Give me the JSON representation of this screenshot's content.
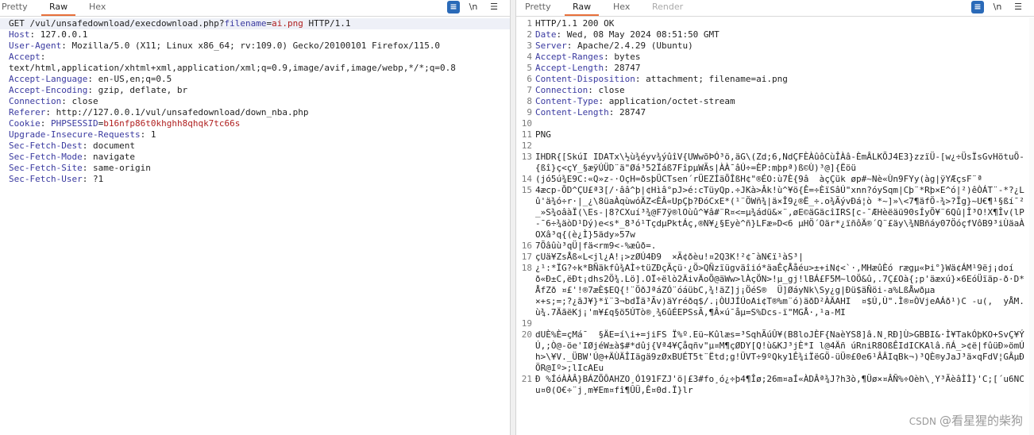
{
  "request": {
    "tabs": [
      "Pretty",
      "Raw",
      "Hex"
    ],
    "active_tab": "Raw",
    "lines": [
      {
        "num": "",
        "parts": [
          [
            "kw",
            "GET /vul/unsafedownload/execdownload.php?"
          ],
          [
            "param",
            "filename"
          ],
          [
            "kw",
            "="
          ],
          [
            "val",
            "ai.png"
          ],
          [
            "kw",
            " HTTP/1.1"
          ]
        ]
      },
      {
        "num": "",
        "parts": [
          [
            "key",
            "Host"
          ],
          [
            "kw",
            ": 127.0.0.1"
          ]
        ]
      },
      {
        "num": "",
        "parts": [
          [
            "key",
            "User-Agent"
          ],
          [
            "kw",
            ": Mozilla/5.0 (X11; Linux x86_64; rv:109.0) Gecko/20100101 Firefox/115.0"
          ]
        ]
      },
      {
        "num": "",
        "parts": [
          [
            "key",
            "Accept"
          ],
          [
            "kw",
            ":"
          ]
        ]
      },
      {
        "num": "",
        "parts": [
          [
            "kw",
            "text/html,application/xhtml+xml,application/xml;q=0.9,image/avif,image/webp,*/*;q=0.8"
          ]
        ]
      },
      {
        "num": "",
        "parts": [
          [
            "key",
            "Accept-Language"
          ],
          [
            "kw",
            ": en-US,en;q=0.5"
          ]
        ]
      },
      {
        "num": "",
        "parts": [
          [
            "key",
            "Accept-Encoding"
          ],
          [
            "kw",
            ": gzip, deflate, br"
          ]
        ]
      },
      {
        "num": "",
        "parts": [
          [
            "key",
            "Connection"
          ],
          [
            "kw",
            ": close"
          ]
        ]
      },
      {
        "num": "",
        "parts": [
          [
            "key",
            "Referer"
          ],
          [
            "kw",
            ": http://127.0.0.1/vul/unsafedownload/down_nba.php"
          ]
        ]
      },
      {
        "num": "",
        "parts": [
          [
            "key",
            "Cookie"
          ],
          [
            "kw",
            ": "
          ],
          [
            "param",
            "PHPSESSID"
          ],
          [
            "kw",
            "="
          ],
          [
            "val",
            "b16nfp86t0khghh8qhqk7tc66s"
          ]
        ]
      },
      {
        "num": "",
        "parts": [
          [
            "key",
            "Upgrade-Insecure-Requests"
          ],
          [
            "kw",
            ": 1"
          ]
        ]
      },
      {
        "num": "",
        "parts": [
          [
            "key",
            "Sec-Fetch-Dest"
          ],
          [
            "kw",
            ": document"
          ]
        ]
      },
      {
        "num": "",
        "parts": [
          [
            "key",
            "Sec-Fetch-Mode"
          ],
          [
            "kw",
            ": navigate"
          ]
        ]
      },
      {
        "num": "",
        "parts": [
          [
            "key",
            "Sec-Fetch-Site"
          ],
          [
            "kw",
            ": same-origin"
          ]
        ]
      },
      {
        "num": "",
        "parts": [
          [
            "key",
            "Sec-Fetch-User"
          ],
          [
            "kw",
            ": ?1"
          ]
        ]
      },
      {
        "num": "",
        "parts": []
      },
      {
        "num": "",
        "parts": []
      }
    ]
  },
  "response": {
    "tabs": [
      "Pretty",
      "Raw",
      "Hex",
      "Render"
    ],
    "active_tab": "Raw",
    "lines": [
      {
        "num": "1",
        "parts": [
          [
            "kw",
            "HTTP/1.1 200 OK"
          ]
        ]
      },
      {
        "num": "2",
        "parts": [
          [
            "key",
            "Date"
          ],
          [
            "kw",
            ": Wed, 08 May 2024 08:51:50 GMT"
          ]
        ]
      },
      {
        "num": "3",
        "parts": [
          [
            "key",
            "Server"
          ],
          [
            "kw",
            ": Apache/2.4.29 (Ubuntu)"
          ]
        ]
      },
      {
        "num": "4",
        "parts": [
          [
            "key",
            "Accept-Ranges"
          ],
          [
            "kw",
            ": bytes"
          ]
        ]
      },
      {
        "num": "5",
        "parts": [
          [
            "key",
            "Accept-Length"
          ],
          [
            "kw",
            ": 28747"
          ]
        ]
      },
      {
        "num": "6",
        "parts": [
          [
            "key",
            "Content-Disposition"
          ],
          [
            "kw",
            ": attachment; filename=ai.png"
          ]
        ]
      },
      {
        "num": "7",
        "parts": [
          [
            "key",
            "Connection"
          ],
          [
            "kw",
            ": close"
          ]
        ]
      },
      {
        "num": "8",
        "parts": [
          [
            "key",
            "Content-Type"
          ],
          [
            "kw",
            ": application/octet-stream"
          ]
        ]
      },
      {
        "num": "9",
        "parts": [
          [
            "key",
            "Content-Length"
          ],
          [
            "kw",
            ": 28747"
          ]
        ]
      },
      {
        "num": "10",
        "parts": []
      },
      {
        "num": "11",
        "parts": [
          [
            "kw",
            "PNG"
          ]
        ]
      },
      {
        "num": "12",
        "parts": []
      },
      {
        "num": "13",
        "parts": [
          [
            "kw",
            "IHDR{[SkúI IDATx\\½ù¾éyv¾ýûîV{UWwõÞÓ³ö,äG\\(Zd;6,NdÇFÈÀûôCùÎÀâ-ÈmÂLKÕJ4E3}zzïÜ-[w¿÷ÜsÏsGvHötuÕ-{ßî}ç<çY_§æÿÚÜD¨ä\"Øá³52Ïáß7FîpµWÃs|ÀÀ¯âÚ÷=ÈP:mþpª)ß©Ù)³@]{Ëöü"
          ]
        ]
      },
      {
        "num": "14",
        "parts": [
          [
            "kw",
            "(jó5ú¾E9C:«Q»z-·OçH=ðsþÜCTsen´rÜEZÍäÕÎßH¢\"®ÉO:ù7È{9â  àçÇük øp#~Nè«Ùn9FYy(àg|ÿYÆçsF¨ª"
          ]
        ]
      },
      {
        "num": "15",
        "parts": [
          [
            "kw",
            "4æcp-ÕD^ÇU£ª3[/·ââ^þ|¢Hìâ°pJ>é:cTüyQp.÷JKà>Âk!ù^¥ö{Ê=÷ÈïSâÚ\"xnn?óySqm|Cþ¨*Rþ×E^ó|²)êÒÁT¨-*?¿Lû'ä¾ó÷r·|_¿\\8üaÀqùwóÄZ<ÈÂ«UpÇþ?ÐóCxE*(¹¨ÖWñ¾|ä×Î9¿®Ë_÷.o¾ÃývÐá¦ò *~]»\\<7¶äfÖ-¾>?Īg}~U€¶¹§ßí¯²_»S¾oâàÏ(\\Es-|8?CXuí³¾@F7ÿ®lOùû^¥â#¨R¤<=µ¾ádü&×¨,øE©äGäcîIRS[c-¯ÆHèëäü90sÍyÕ¥¨6Qû|Î³O!X¶Îv(lP-¯6÷¾äòD¹Dý)e<s*_8³ó¹TçdµPktÁç,®N¥¿§Eyè^ñ}LFæ»D<6 µHÖ´Oär*¿ïñôÄ®´Q¨£äy\\¾NBñáy07ÖóçfVôB9³iÙäaÀOXâ³q{(è¿Ì}5ädy»57w"
          ]
        ]
      },
      {
        "num": "16",
        "parts": [
          [
            "kw",
            "7Õâûù³qÜ|fä<rm9<-%æûð=."
          ]
        ]
      },
      {
        "num": "17",
        "parts": [
          [
            "kw",
            "çUä¥ZsÅß«L<jl¿A!¡>zØÚ4Ð9  ×Ã¢ðèu!¤2Q3K!²¢¯àN€ï¹àS³|"
          ]
        ]
      },
      {
        "num": "18",
        "parts": [
          [
            "kw",
            "¿¹:*ÏG?÷k*BÑäkfû¾AÌ÷tüZÐçÃçü·¿Ö>QÑzïügväîió*äaÊçÅåéu>±+iN¢<`·,MHæûÈó rægµ«Þi°}Wä¢ÁM¹9ëj¡doíð«Ð±C,ëÐt¡dhs2Ö¾.Lö].OÏ÷ëlò2ÄivÄoÕ@äWw>lÀçÖN>!µ_gj!lBÁ£F5M~lOÖ&û,.7Ç£Oà{;p'äæxú}×6EóÜïäp-ð·D*ÅfZð ¤£'!®7æÈ$EQ{!¨ÖðJªáZÓ¨óáübC,¾!äZ]j¡ÖéS®  Ü]ØáyNk\\Sy¿g|Ðü$äÑöi-a%LßÅwðµa"
          ]
        ]
      },
      {
        "num": "",
        "parts": [
          [
            "kw",
            "×+s;=;?¿ãJ¥}*ï¨3¬bdÏä³Ãv)äYréðq$/.¡ÒUJÍÚoAi¢T®%m¨ó)äðD²ÀÄAHI  ¤$Ú,Ù\".Ì®¤ÒVjeAÁð¹)C -u(,  yÅM.ù¾.7ÄãëKj¡'m¥£q§ö5ÚTò®¸¾6ûÉEPSsÃ,¶Â×ú¯åµ=S%Dcs-ï\"MGÅ·,¹a-MI"
          ]
        ]
      },
      {
        "num": "19",
        "parts": []
      },
      {
        "num": "20",
        "parts": [
          [
            "kw",
            "dUÈ%È=çMá¯  §ÄE=í\\i+=jiFS Ï%º.Eü~Kûlæs=³SqhÃúÛ¥(B8loJÈF{NaèYS8]â.N¸RÐ]Ù>GBBI&·Ì¥TakÓþKO+SvÇ¥ÝÚ,;Ò@-öe'IØjéW±à$#*dûj{Vª4¥Çåqñv\"µ¤M¶çØDY[Q!ù&KJ³jÈ*I l@4Äñ úRniR8OßÊIdICKAlâ.ñÁ_>¢ë|fûüÐ»ömÚh>\\¥V._ÜBW'Ú@+ÄÙÄÎIägä9zØxBUÉT5t¨Ëtd;g!ÜVT÷9ºQky1Ê¾iÏëGÖ-üÜ®£0e6¹ÂÂIqBk¬)³QÈ®yJaJ³ä×qFdV¦GÂµÐÖR@Iº>;lIcAEu"
          ]
        ]
      },
      {
        "num": "21",
        "parts": [
          [
            "kw",
            "Ð %ÍóÀÀÂ}BÁZÕÔAHZO¸Ó191FZJ'ö|£3#fo¸ó¿÷þ4¶Îø;26m¤aÍ«ÀDÂª¾J?h3ò,¶Üø×¤ÂÑ%÷Oèh\\¸Y³ÃèâÌÌ}'C;[´u6NCu¤0(O€÷¨j¸m¥Em¤fî¶ÛÜ,Ê¤0d.Ï}lr"
          ]
        ]
      }
    ]
  },
  "toolbar": {
    "wrap_icon": "list-lines-icon",
    "newline_label": "\\n",
    "menu_icon": "menu-icon"
  },
  "watermark": {
    "small": "CSDN",
    "text": "@看星猩的柴狗"
  }
}
